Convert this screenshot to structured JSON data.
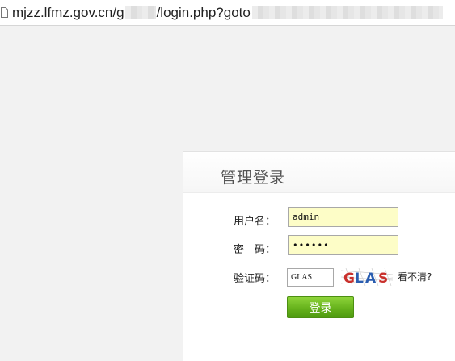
{
  "browser": {
    "url_host": "mjzz.lfmz.gov.cn/g",
    "url_path": "/login.php?goto"
  },
  "login": {
    "title": "管理登录",
    "username_label": "用户名：",
    "username_value": "admin",
    "password_label": "密　码：",
    "password_value": "••••••",
    "captcha_label": "验证码：",
    "captcha_value": "GLAS",
    "captcha_image_text": [
      "G",
      "L",
      "A",
      "S"
    ],
    "refresh_label": "看不清?",
    "submit_label": "登录"
  },
  "colors": {
    "input_bg": "#fdfdc7",
    "button_green": "#66b21c",
    "captcha_red": "#c9302c",
    "captcha_blue": "#2a5db0"
  }
}
